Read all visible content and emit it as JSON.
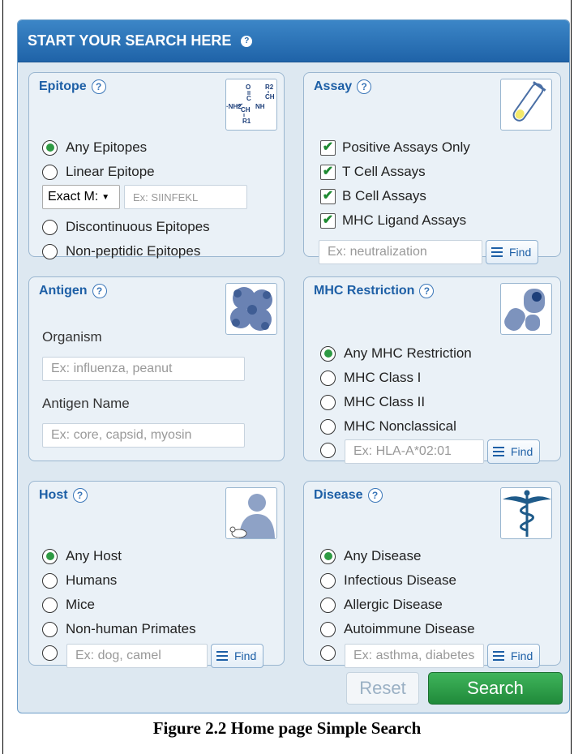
{
  "header": {
    "title": "START YOUR SEARCH HERE",
    "help": "?"
  },
  "epitope": {
    "title": "Epitope",
    "help": "?",
    "options": [
      "Any Epitopes",
      "Linear Epitope",
      "Discontinuous Epitopes",
      "Non-peptidic Epitopes"
    ],
    "match_select": "Exact M:",
    "sequence_placeholder": "Ex: SIINFEKL",
    "structure_labels": {
      "o": "O",
      "r2": "R2",
      "c": "C",
      "ch_top": "CH",
      "nh2": "·NH2",
      "ch": "CH",
      "nh": "NH",
      "r1": "R1"
    }
  },
  "assay": {
    "title": "Assay",
    "help": "?",
    "checks": [
      "Positive Assays Only",
      "T Cell Assays",
      "B Cell Assays",
      "MHC Ligand Assays"
    ],
    "placeholder": "Ex: neutralization",
    "find": "Find"
  },
  "antigen": {
    "title": "Antigen",
    "help": "?",
    "organism_label": "Organism",
    "organism_placeholder": "Ex: influenza, peanut",
    "name_label": "Antigen Name",
    "name_placeholder": "Ex: core, capsid, myosin"
  },
  "mhc": {
    "title": "MHC Restriction",
    "help": "?",
    "options": [
      "Any MHC Restriction",
      "MHC Class I",
      "MHC Class II",
      "MHC Nonclassical"
    ],
    "placeholder": "Ex: HLA-A*02:01",
    "find": "Find"
  },
  "host": {
    "title": "Host",
    "help": "?",
    "options": [
      "Any Host",
      "Humans",
      "Mice",
      "Non-human Primates"
    ],
    "placeholder": "Ex: dog, camel",
    "find": "Find"
  },
  "disease": {
    "title": "Disease",
    "help": "?",
    "options": [
      "Any Disease",
      "Infectious Disease",
      "Allergic Disease",
      "Autoimmune Disease"
    ],
    "placeholder": "Ex: asthma, diabetes",
    "find": "Find"
  },
  "buttons": {
    "reset": "Reset",
    "search": "Search"
  },
  "caption": "Figure 2.2  Home page Simple Search",
  "colors": {
    "header": "#2e77bd",
    "accent": "#1d5fa6",
    "search_green": "#2e9a43",
    "check_green": "#1e8a32"
  }
}
